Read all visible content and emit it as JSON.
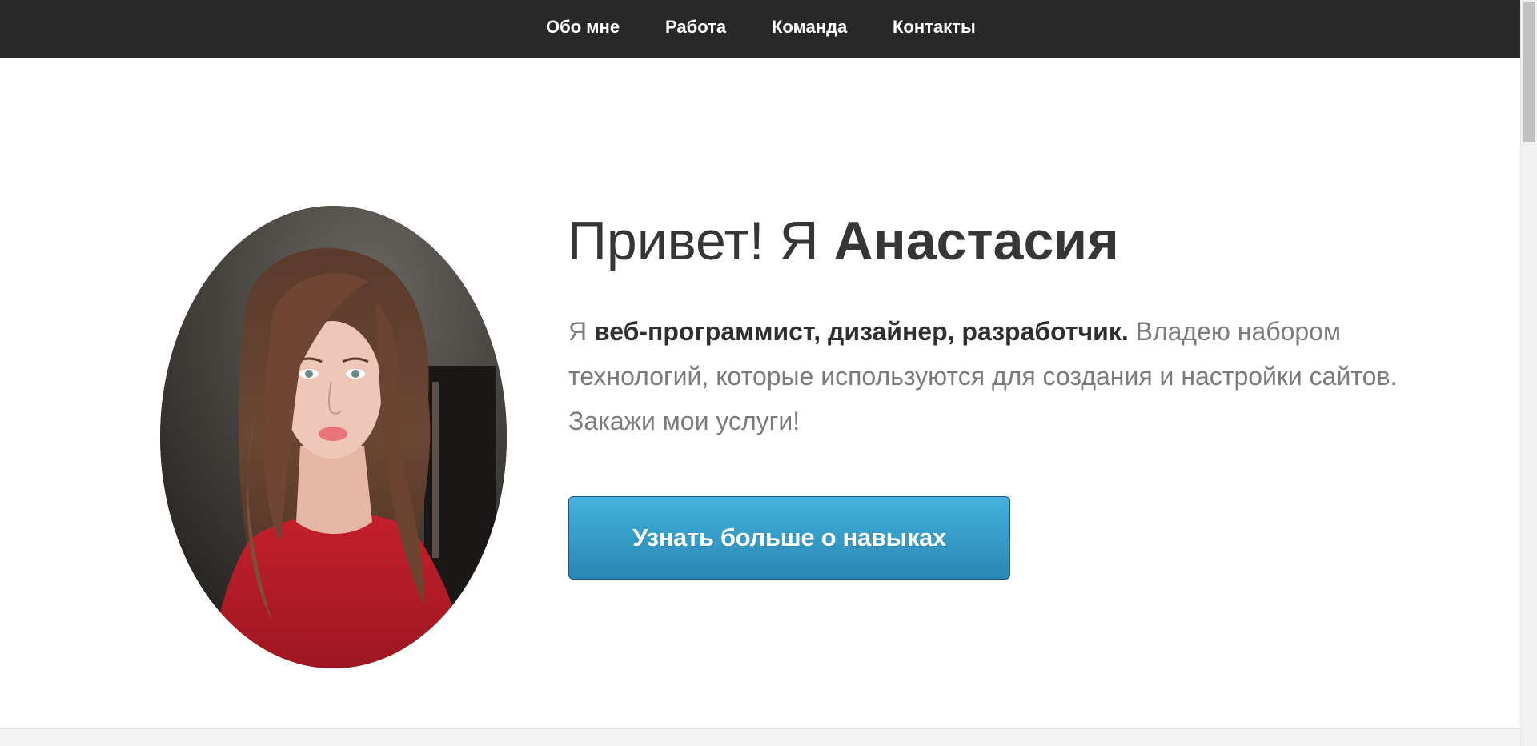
{
  "nav": {
    "items": [
      {
        "label": "Обо мне"
      },
      {
        "label": "Работа"
      },
      {
        "label": "Команда"
      },
      {
        "label": "Контакты"
      }
    ]
  },
  "hero": {
    "title_prefix": "Привет! Я ",
    "title_name": "Анастасия",
    "text_prefix": "Я ",
    "text_bold": "веб-программист, дизайнер, разработчик.",
    "text_rest": " Владею набором технологий, которые используются для создания и настройки сайтов. Закажи мои услуги!",
    "button_label": "Узнать больше о навыках"
  },
  "colors": {
    "nav_background": "#282828",
    "button_top": "#43b1de",
    "button_bottom": "#2a87b2",
    "title_text": "#363636",
    "body_text": "#7b7b7b"
  },
  "icons": {
    "avatar": "portrait-photo"
  }
}
